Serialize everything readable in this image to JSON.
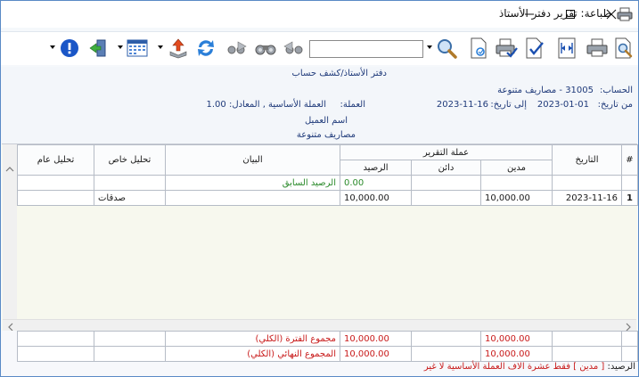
{
  "window": {
    "title": "طباعة: تقرير دفتر الأستاذ"
  },
  "colors": {
    "accent": "#1f3a7a",
    "border": "#5a8ac6",
    "highlight_green": "#2a8a2a",
    "highlight_red": "#c81a1a"
  },
  "toolbar": {
    "search_value": "",
    "icons": [
      "help-icon",
      "exit-icon",
      "calendar-icon",
      "export-icon",
      "refresh-icon",
      "next-icon",
      "binoculars-icon",
      "previous-icon",
      "search-icon",
      "settings-doc-icon",
      "print-check-icon",
      "doc-check-icon",
      "fit-width-icon",
      "print-icon",
      "print-preview-icon"
    ]
  },
  "report": {
    "title": "دفتر الأستاذ/كشف حساب",
    "account_label": "الحساب:",
    "account_value": "31005 - مصاريف متنوعة",
    "date_from_label": "من تاريخ:",
    "date_from": "2023-01-01",
    "date_to_label": "إلى تاريخ:",
    "date_to": "2023-11-16",
    "currency_label": "العملة:",
    "currency_value": "العملة الأساسية , المعادل: 1.00",
    "customer_name_label": "اسم العميل",
    "customer_name": "مصاريف متنوعة"
  },
  "grid": {
    "headers": {
      "index": "#",
      "date": "التاريخ",
      "report_currency": "عملة التقرير",
      "debit": "مدين",
      "credit": "دائن",
      "balance": "الرصيد",
      "statement": "البيان",
      "special_analysis": "تحليل خاص",
      "general_analysis": "تحليل عام"
    },
    "opening": {
      "balance": "0.00",
      "statement": "الرصيد السابق"
    },
    "rows": [
      {
        "index": "1",
        "date": "2023-11-16",
        "debit": "10,000.00",
        "credit": "",
        "balance": "10,000.00",
        "statement": "",
        "special": "صدقات",
        "general": ""
      }
    ]
  },
  "footer": {
    "period_total_label": "مجموع الفترة (الكلي)",
    "period_total_debit": "10,000.00",
    "period_total_balance": "10,000.00",
    "final_total_label": "المجموع النهائي (الكلي)",
    "final_total_debit": "10,000.00",
    "final_total_balance": "10,000.00",
    "balance_label": "الرصيد:",
    "balance_text": "[ مدين ] فقط عشرة الاف العملة الأساسية لا غير"
  }
}
